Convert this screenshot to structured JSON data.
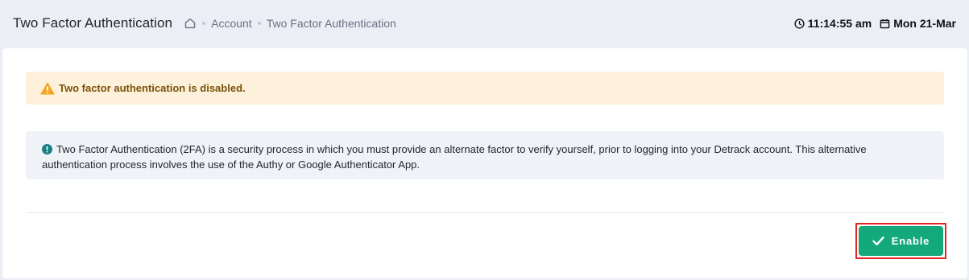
{
  "header": {
    "title": "Two Factor Authentication",
    "breadcrumb": {
      "home_icon": "home-icon",
      "items": [
        "Account",
        "Two Factor Authentication"
      ]
    },
    "time": "11:14:55 am",
    "date": "Mon 21-Mar",
    "clock_icon": "clock-icon",
    "calendar_icon": "calendar-icon"
  },
  "alerts": {
    "warning_text": "Two factor authentication is disabled.",
    "info_text": "Two Factor Authentication (2FA) is a security process in which you must provide an alternate factor to verify yourself, prior to logging into your Detrack account. This alternative authentication process involves the use of the Authy or Google Authenticator App."
  },
  "actions": {
    "enable_label": "Enable"
  },
  "colors": {
    "warning_bg": "#fdf1dc",
    "warning_text": "#7a5208",
    "info_bg": "#eff2f6",
    "enable_button": "#13a97a",
    "highlight_border": "#e0261f"
  }
}
